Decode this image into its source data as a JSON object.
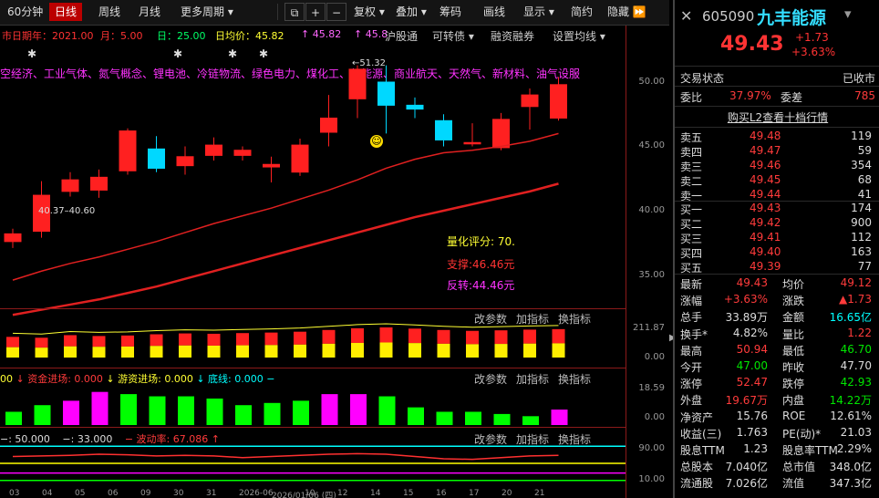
{
  "toolbar": {
    "tabs": [
      "60分钟",
      "日线",
      "周线",
      "月线",
      "更多周期"
    ],
    "icons": [
      "⧉",
      "+",
      "−"
    ],
    "menus": [
      "复权",
      "叠加",
      "筹码",
      "画线",
      "显示",
      "简约",
      "隐藏"
    ]
  },
  "info_line": {
    "part1": "市日期年：2021.00",
    "part2": "月：5.00",
    "part3": "日：25.00",
    "part4": "日均价：45.82",
    "part5": "↑ 45.82",
    "part6": "↑ 45.8"
  },
  "right_buttons": [
    "沪股通",
    "可转债",
    "融资融券",
    "设置均线"
  ],
  "concepts": "空经济、工业气体、氮气概念、锂电池、冷链物流、绿色电力、煤化工、氢能源、商业航天、天然气、新材料、油气设服",
  "chart_labels": {
    "high_marker": "51.32",
    "low_marker": "40.37–40.60",
    "score": "量化评分: 70.",
    "support": "支撑:46.46元",
    "reversal": "反转:44.46元"
  },
  "price_axis": [
    "50.00",
    "45.00",
    "40.00",
    "35.00"
  ],
  "sub1": {
    "axis": [
      "211.87",
      "0.00"
    ],
    "buttons": [
      "改参数",
      "加指标",
      "换指标"
    ]
  },
  "sub2": {
    "legend": [
      "00",
      "↓ 资金进场: 0.000",
      "↓ 游资进场: 0.000",
      "↓ 底线: 0.000",
      "−"
    ],
    "axis": [
      "18.59",
      "0.00"
    ],
    "buttons": [
      "改参数",
      "加指标",
      "换指标"
    ]
  },
  "sub3": {
    "legend": [
      "−: 50.000",
      "−: 33.000",
      "− 波动率: 67.086",
      "↑"
    ],
    "axis": [
      "90.00",
      "10.00"
    ],
    "buttons": [
      "改参数",
      "加指标",
      "换指标"
    ]
  },
  "date_axis": [
    "03",
    "04",
    "05",
    "06",
    "09",
    "30",
    "31",
    "2026-06",
    "2026/01/06 (四)",
    "10",
    "12",
    "14",
    "15",
    "16",
    "17",
    "20",
    "21"
  ],
  "chart_data": {
    "type": "candlestick",
    "candles": [
      {
        "o": 37.6,
        "c": 38.2,
        "h": 38.6,
        "l": 37.1
      },
      {
        "o": 38.4,
        "c": 41.2,
        "h": 42.3,
        "l": 37.9
      },
      {
        "o": 41.5,
        "c": 42.4,
        "h": 43.0,
        "l": 41.1
      },
      {
        "o": 41.6,
        "c": 42.6,
        "h": 43.2,
        "l": 41.0
      },
      {
        "o": 43.1,
        "c": 46.2,
        "h": 46.4,
        "l": 42.8
      },
      {
        "o": 44.8,
        "c": 43.3,
        "h": 45.8,
        "l": 43.0
      },
      {
        "o": 43.5,
        "c": 44.2,
        "h": 45.0,
        "l": 42.8
      },
      {
        "o": 44.3,
        "c": 45.1,
        "h": 45.7,
        "l": 43.9
      },
      {
        "o": 44.3,
        "c": 44.7,
        "h": 45.0,
        "l": 43.9
      },
      {
        "o": 43.4,
        "c": 43.6,
        "h": 44.2,
        "l": 42.2
      },
      {
        "o": 43.0,
        "c": 45.1,
        "h": 45.6,
        "l": 42.7
      },
      {
        "o": 46.1,
        "c": 47.2,
        "h": 49.0,
        "l": 45.0
      },
      {
        "o": 48.7,
        "c": 51.0,
        "h": 51.3,
        "l": 47.2
      },
      {
        "o": 50.0,
        "c": 48.2,
        "h": 51.3,
        "l": 46.0
      },
      {
        "o": 48.2,
        "c": 47.9,
        "h": 48.8,
        "l": 47.2
      },
      {
        "o": 47.0,
        "c": 45.5,
        "h": 47.5,
        "l": 45.0
      },
      {
        "o": 45.2,
        "c": 45.3,
        "h": 46.8,
        "l": 45.0
      },
      {
        "o": 44.9,
        "c": 47.1,
        "h": 47.6,
        "l": 44.7
      },
      {
        "o": 48.1,
        "c": 49.0,
        "h": 49.5,
        "l": 46.3
      },
      {
        "o": 47.2,
        "c": 49.8,
        "h": 50.4,
        "l": 47.0
      }
    ],
    "ma_short": [
      34.6,
      35.3,
      35.9,
      36.4,
      37.0,
      37.6,
      38.3,
      39.0,
      39.6,
      40.2,
      40.9,
      41.6,
      42.4,
      43.3,
      44.0,
      44.5,
      44.7,
      45.0,
      45.4,
      46.0
    ],
    "ma_long": [
      31.9,
      32.3,
      32.7,
      33.1,
      33.6,
      34.1,
      34.7,
      35.3,
      35.9,
      36.5,
      37.1,
      37.7,
      38.3,
      38.9,
      39.5,
      40.0,
      40.5,
      41.0,
      41.5,
      42.1
    ],
    "volume": [
      120,
      115,
      130,
      125,
      128,
      135,
      140,
      138,
      142,
      145,
      150,
      160,
      170,
      175,
      168,
      160,
      155,
      158,
      162,
      165
    ],
    "capital": [
      {
        "v": 6,
        "c": "#00ff00"
      },
      {
        "v": 9,
        "c": "#00ff00"
      },
      {
        "v": 11,
        "c": "#ff00ff"
      },
      {
        "v": 15,
        "c": "#ff00ff"
      },
      {
        "v": 14,
        "c": "#00ff00"
      },
      {
        "v": 13,
        "c": "#00ff00"
      },
      {
        "v": 13,
        "c": "#00ff00"
      },
      {
        "v": 12,
        "c": "#00ff00"
      },
      {
        "v": 9,
        "c": "#00ff00"
      },
      {
        "v": 10,
        "c": "#00ff00"
      },
      {
        "v": 11,
        "c": "#00ff00"
      },
      {
        "v": 14,
        "c": "#ff00ff"
      },
      {
        "v": 14,
        "c": "#ff00ff"
      },
      {
        "v": 13,
        "c": "#00ff00"
      },
      {
        "v": 8,
        "c": "#00ff00"
      },
      {
        "v": 6,
        "c": "#00ff00"
      },
      {
        "v": 6,
        "c": "#00ff00"
      },
      {
        "v": 5,
        "c": "#00ff00"
      },
      {
        "v": 4,
        "c": "#00ff00"
      },
      {
        "v": 7,
        "c": "#ff00ff"
      }
    ],
    "vol_line": [
      62,
      63,
      64,
      66,
      65,
      63,
      64,
      63,
      60,
      62,
      64,
      66,
      67,
      66,
      62,
      58,
      57,
      60,
      63,
      64
    ]
  },
  "quote": {
    "code": "605090",
    "name": "九丰能源",
    "price": "49.43",
    "change": "+1.73",
    "pct": "+3.63%",
    "status_label": "交易状态",
    "status_val": "已收市",
    "wb_label": "委比",
    "wb_val": "37.97%",
    "wc_label": "委差",
    "wc_val": "785",
    "l2": "购买L2查看十档行情",
    "asks": [
      {
        "l": "卖五",
        "p": "49.48",
        "v": "119"
      },
      {
        "l": "卖四",
        "p": "49.47",
        "v": "59"
      },
      {
        "l": "卖三",
        "p": "49.46",
        "v": "354"
      },
      {
        "l": "卖二",
        "p": "49.45",
        "v": "68"
      },
      {
        "l": "卖一",
        "p": "49.44",
        "v": "41"
      }
    ],
    "bids": [
      {
        "l": "买一",
        "p": "49.43",
        "v": "174"
      },
      {
        "l": "买二",
        "p": "49.42",
        "v": "900"
      },
      {
        "l": "买三",
        "p": "49.41",
        "v": "112"
      },
      {
        "l": "买四",
        "p": "49.40",
        "v": "163"
      },
      {
        "l": "买五",
        "p": "49.39",
        "v": "77"
      }
    ],
    "stats": [
      [
        "最新",
        "49.43",
        "red",
        "均价",
        "49.12",
        "red"
      ],
      [
        "涨幅",
        "+3.63%",
        "red",
        "涨跌",
        "▲1.73",
        "red"
      ],
      [
        "总手",
        "33.89万",
        "white",
        "金额",
        "16.65亿",
        "cyan"
      ],
      [
        "换手*",
        "4.82%",
        "white",
        "量比",
        "1.22",
        "red"
      ],
      [
        "最高",
        "50.94",
        "red",
        "最低",
        "46.70",
        "green"
      ],
      [
        "今开",
        "47.00",
        "green",
        "昨收",
        "47.70",
        "white"
      ],
      [
        "涨停",
        "52.47",
        "red",
        "跌停",
        "42.93",
        "green"
      ],
      [
        "外盘",
        "19.67万",
        "red",
        "内盘",
        "14.22万",
        "green"
      ],
      [
        "净资产",
        "15.76",
        "white",
        "ROE",
        "12.61%",
        "white"
      ],
      [
        "收益(三)",
        "1.763",
        "white",
        "PE(动)*",
        "21.03",
        "white"
      ],
      [
        "股息TTM",
        "1.23",
        "white",
        "股息率TTM",
        "2.29%",
        "white"
      ],
      [
        "总股本",
        "7.040亿",
        "white",
        "总市值",
        "348.0亿",
        "white"
      ],
      [
        "流通股",
        "7.026亿",
        "white",
        "流值",
        "347.3亿",
        "white"
      ]
    ]
  }
}
